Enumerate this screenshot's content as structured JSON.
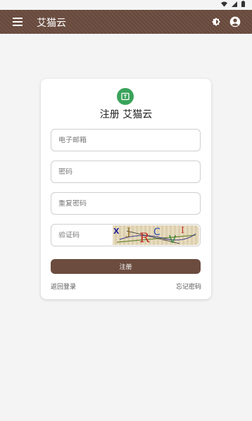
{
  "status_bar": {
    "icons": [
      "wifi-icon",
      "signal-icon",
      "battery-icon"
    ]
  },
  "app_bar": {
    "title": "艾猫云",
    "menu_icon": "menu-icon",
    "theme_icon": "brightness-icon",
    "account_icon": "account-circle-icon",
    "color": "#6b4c3f"
  },
  "card": {
    "title": "注册 艾猫云",
    "logo_icon": "book-icon",
    "logo_color": "#3aa35a",
    "fields": {
      "email": {
        "placeholder": "电子邮箱",
        "value": ""
      },
      "password": {
        "placeholder": "密码",
        "value": ""
      },
      "confirm_password": {
        "placeholder": "重复密码",
        "value": ""
      },
      "captcha": {
        "placeholder": "验证码",
        "value": ""
      }
    },
    "captcha_image": {
      "text": "XJRCVI"
    },
    "register_button": "注册",
    "back_login_link": "返回登录",
    "forgot_password_link": "忘记密码"
  }
}
